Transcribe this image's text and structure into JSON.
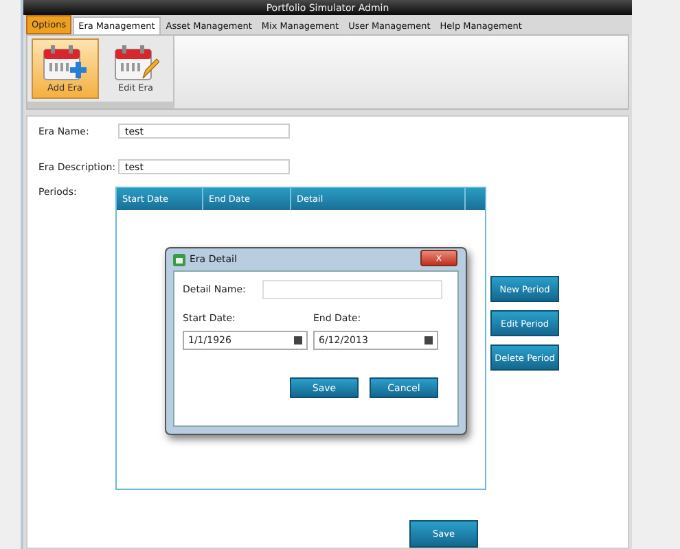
{
  "window": {
    "title": "Portfolio Simulator Admin"
  },
  "tabs": [
    {
      "label": "Options",
      "kind": "app-menu",
      "selected": false
    },
    {
      "label": "Era Management",
      "kind": "tab",
      "selected": true
    },
    {
      "label": "Asset Management",
      "kind": "tab",
      "selected": false
    },
    {
      "label": "Mix Management",
      "kind": "tab",
      "selected": false
    },
    {
      "label": "User Management",
      "kind": "tab",
      "selected": false
    },
    {
      "label": "Help Management",
      "kind": "tab",
      "selected": false
    }
  ],
  "ribbon": {
    "buttons": [
      {
        "label": "Add Era",
        "kind": "add",
        "selected": true
      },
      {
        "label": "Edit Era",
        "kind": "edit",
        "selected": false
      }
    ]
  },
  "form": {
    "fields": [
      {
        "label": "Era Name:",
        "value": "test"
      },
      {
        "label": "Era Description:",
        "value": "test"
      }
    ],
    "periods_label": "Periods:",
    "table": {
      "columns": [
        "Start Date",
        "End Date",
        "Detail"
      ]
    },
    "side_buttons": [
      "New Period",
      "Edit Period",
      "Delete Period"
    ],
    "save_button": "Save"
  },
  "dialog": {
    "title": "Era Detail",
    "close": "x",
    "detail_name": {
      "label": "Detail Name:"
    },
    "start_date": {
      "label": "Start Date:",
      "value": "1/1/1926"
    },
    "end_date": {
      "label": "End Date:",
      "value": "6/12/2013"
    },
    "buttons": [
      "Save",
      "Cancel"
    ]
  }
}
